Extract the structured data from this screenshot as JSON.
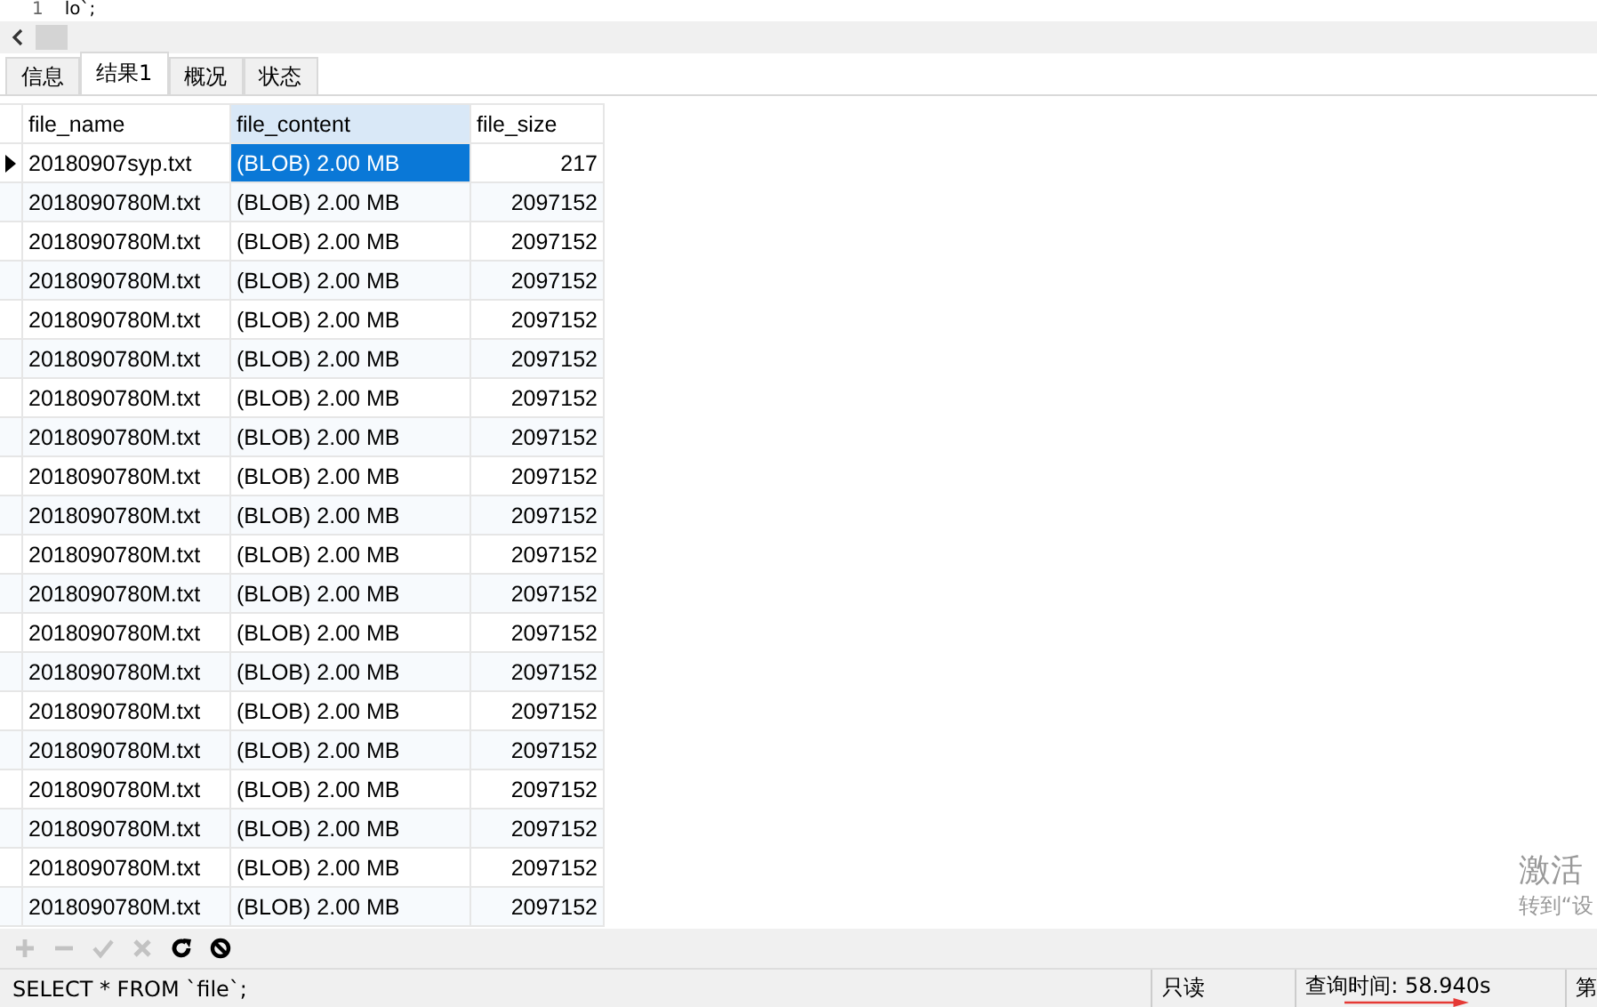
{
  "editor": {
    "line_number": "1",
    "line_text": "lo`;"
  },
  "tabs": [
    {
      "label": "信息",
      "selected": false
    },
    {
      "label": "结果1",
      "selected": true
    },
    {
      "label": "概况",
      "selected": false
    },
    {
      "label": "状态",
      "selected": false
    }
  ],
  "table": {
    "columns": [
      {
        "label": "file_name",
        "selected": false
      },
      {
        "label": "file_content",
        "selected": true
      },
      {
        "label": "file_size",
        "selected": false
      }
    ],
    "rows": [
      {
        "current": true,
        "cells": [
          "20180907syp.txt",
          "(BLOB) 2.00 MB",
          "217"
        ]
      },
      {
        "current": false,
        "cells": [
          "2018090780M.txt",
          "(BLOB) 2.00 MB",
          "2097152"
        ]
      },
      {
        "current": false,
        "cells": [
          "2018090780M.txt",
          "(BLOB) 2.00 MB",
          "2097152"
        ]
      },
      {
        "current": false,
        "cells": [
          "2018090780M.txt",
          "(BLOB) 2.00 MB",
          "2097152"
        ]
      },
      {
        "current": false,
        "cells": [
          "2018090780M.txt",
          "(BLOB) 2.00 MB",
          "2097152"
        ]
      },
      {
        "current": false,
        "cells": [
          "2018090780M.txt",
          "(BLOB) 2.00 MB",
          "2097152"
        ]
      },
      {
        "current": false,
        "cells": [
          "2018090780M.txt",
          "(BLOB) 2.00 MB",
          "2097152"
        ]
      },
      {
        "current": false,
        "cells": [
          "2018090780M.txt",
          "(BLOB) 2.00 MB",
          "2097152"
        ]
      },
      {
        "current": false,
        "cells": [
          "2018090780M.txt",
          "(BLOB) 2.00 MB",
          "2097152"
        ]
      },
      {
        "current": false,
        "cells": [
          "2018090780M.txt",
          "(BLOB) 2.00 MB",
          "2097152"
        ]
      },
      {
        "current": false,
        "cells": [
          "2018090780M.txt",
          "(BLOB) 2.00 MB",
          "2097152"
        ]
      },
      {
        "current": false,
        "cells": [
          "2018090780M.txt",
          "(BLOB) 2.00 MB",
          "2097152"
        ]
      },
      {
        "current": false,
        "cells": [
          "2018090780M.txt",
          "(BLOB) 2.00 MB",
          "2097152"
        ]
      },
      {
        "current": false,
        "cells": [
          "2018090780M.txt",
          "(BLOB) 2.00 MB",
          "2097152"
        ]
      },
      {
        "current": false,
        "cells": [
          "2018090780M.txt",
          "(BLOB) 2.00 MB",
          "2097152"
        ]
      },
      {
        "current": false,
        "cells": [
          "2018090780M.txt",
          "(BLOB) 2.00 MB",
          "2097152"
        ]
      },
      {
        "current": false,
        "cells": [
          "2018090780M.txt",
          "(BLOB) 2.00 MB",
          "2097152"
        ]
      },
      {
        "current": false,
        "cells": [
          "2018090780M.txt",
          "(BLOB) 2.00 MB",
          "2097152"
        ]
      },
      {
        "current": false,
        "cells": [
          "2018090780M.txt",
          "(BLOB) 2.00 MB",
          "2097152"
        ]
      },
      {
        "current": false,
        "cells": [
          "2018090780M.txt",
          "(BLOB) 2.00 MB",
          "2097152"
        ]
      }
    ]
  },
  "toolbar": [
    {
      "kind": "add",
      "disabled": true
    },
    {
      "kind": "delete",
      "disabled": true
    },
    {
      "kind": "apply",
      "disabled": true
    },
    {
      "kind": "cancel",
      "disabled": true
    },
    {
      "kind": "refresh",
      "disabled": false
    },
    {
      "kind": "stop",
      "disabled": false
    }
  ],
  "activation": {
    "title": "激活",
    "subtitle": "转到“设"
  },
  "status_bar": {
    "sql": "SELECT * FROM `file`;",
    "mode": "只读",
    "query_time": "查询时间: 58.940s",
    "record": "第"
  }
}
